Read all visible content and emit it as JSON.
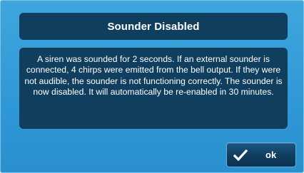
{
  "dialog": {
    "title": "Sounder Disabled",
    "message": "A siren was sounded for 2 seconds. If an external sounder is connected, 4 chirps were emitted from the bell output.  If they were not audible, the sounder is not functioning correctly. The sounder is now disabled. It will automatically be re-enabled in 30 minutes.",
    "ok_label": "ok",
    "ok_icon": "checkmark-icon"
  },
  "colors": {
    "background": "#2f98d6",
    "panel": "#103e5e",
    "text": "#ffffff"
  }
}
